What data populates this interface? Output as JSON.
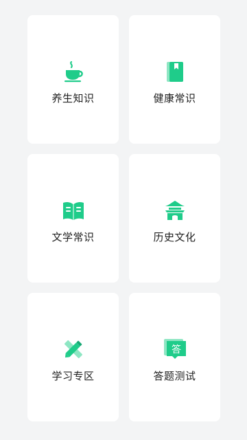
{
  "colors": {
    "background": "#f3f4f5",
    "card": "#ffffff",
    "accent": "#1fcc8a",
    "accent_dark": "#17a874",
    "text": "#222222"
  },
  "cards": [
    {
      "label": "养生知识",
      "icon": "teacup-icon"
    },
    {
      "label": "健康常识",
      "icon": "book-bookmark-icon"
    },
    {
      "label": "文学常识",
      "icon": "open-book-icon"
    },
    {
      "label": "历史文化",
      "icon": "pavilion-icon"
    },
    {
      "label": "学习专区",
      "icon": "pencil-ruler-icon"
    },
    {
      "label": "答题测试",
      "icon": "answer-chat-icon"
    }
  ]
}
